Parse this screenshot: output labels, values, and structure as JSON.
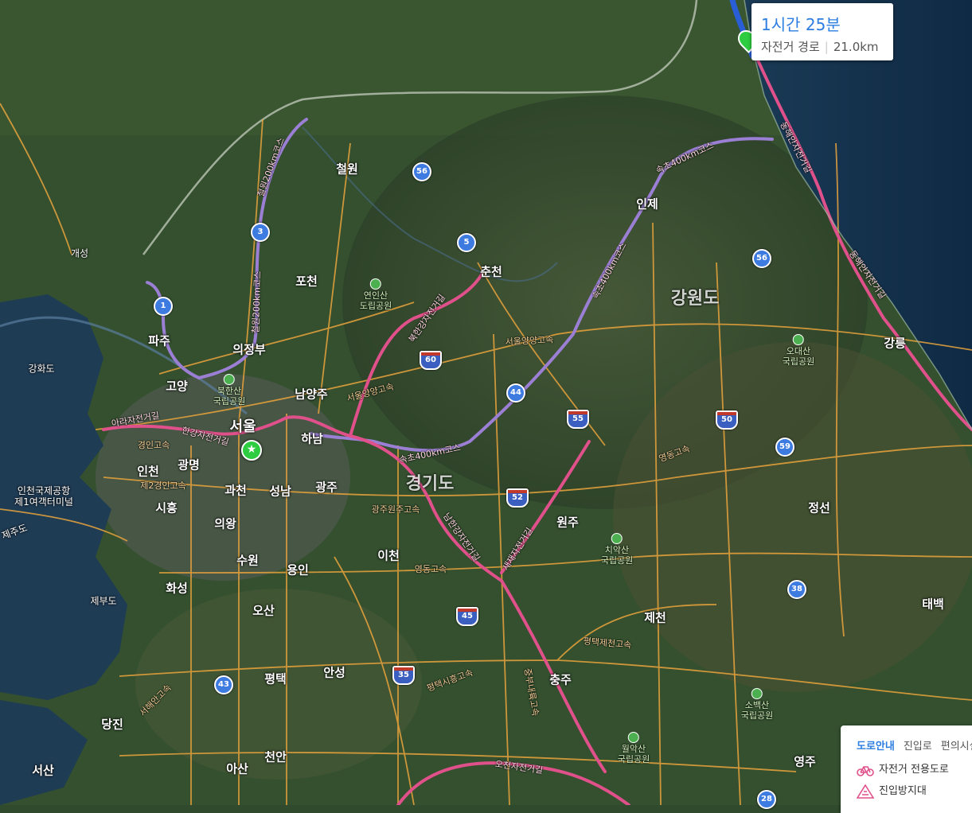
{
  "route_card": {
    "duration": "1시간 25분",
    "type": "자전거 경로",
    "distance": "21.0km"
  },
  "legend": {
    "tabs": [
      "도로안내",
      "진입로",
      "편의시설"
    ],
    "active_tab": "도로안내",
    "items": [
      {
        "icon": "bicycle-icon",
        "label": "자전거 전용도로"
      },
      {
        "icon": "warning-triangle-icon",
        "label": "진입방지대"
      }
    ]
  },
  "places": {
    "cheorwon": "철원",
    "inje": "인제",
    "pocheon": "포천",
    "chuncheon": "춘천",
    "gangwon": "강원도",
    "uijeongbu": "의정부",
    "paju": "파주",
    "goyang": "고양",
    "namyangju": "남양주",
    "seoul": "서울",
    "hanam": "하남",
    "incheon": "인천",
    "gwangmyeong": "광명",
    "gwacheon": "과천",
    "seongnam": "성남",
    "gwangju": "광주",
    "gyeonggi": "경기도",
    "siheung": "시흥",
    "uiwang": "의왕",
    "wonju": "원주",
    "icheon": "이천",
    "suwon": "수원",
    "yongin": "용인",
    "hwaseong": "화성",
    "osan": "오산",
    "jecheon": "제천",
    "gangneung": "강릉",
    "jeongseon": "정선",
    "taebaek": "태백",
    "anseong": "안성",
    "pyeongtaek": "평택",
    "chungju": "충주",
    "dangjin": "당진",
    "cheonan": "천안",
    "asan": "아산",
    "seosan": "서산",
    "yeongju": "영주",
    "ganghwa": "강화도",
    "gaeseong": "개성",
    "jebu": "제부도",
    "airport": "인천국제공항\n제1여객터미널",
    "jeju": "제주도"
  },
  "parks": {
    "yeoninsan": "연인산\n도립공원",
    "bukhansan": "북한산\n국립공원",
    "odaesan": "오대산\n국립공원",
    "chiaksan": "치악산\n국립공원",
    "sobaeksan": "소백산\n국립공원",
    "woraksan": "월악산\n국립공원"
  },
  "highways": [
    "3",
    "1",
    "56",
    "5",
    "60",
    "44",
    "55",
    "50",
    "59",
    "52",
    "56",
    "38",
    "45",
    "35",
    "43",
    "28"
  ],
  "road_labels": {
    "bukhan": "북한강자전거길",
    "soraksan": "속초400km코스",
    "cheorwon200": "철원200km코스",
    "ara": "아라자전거길",
    "hangang": "한강자전거길",
    "namhan": "남한강자전거길",
    "saejae": "새재자전거길",
    "ocheon": "오천자전거길",
    "donghae": "동해안자전거길",
    "seoulyangyang": "서울양양고속",
    "gyeongin": "경인고속",
    "jeil2": "제2경인고속",
    "gwangjuwonju": "광주원주고속",
    "yeongdong": "영동고속",
    "pyeongje": "평택제천고속",
    "jungbu": "중부내륙고속",
    "seohaean": "서해안고속",
    "pyeongtaekdongtan": "평택시흥고속"
  },
  "colors": {
    "route_pink": "#e0508a",
    "route_purple": "#9b7fd4",
    "road_orange": "#e8a33c",
    "sea": "#1d3d58"
  }
}
